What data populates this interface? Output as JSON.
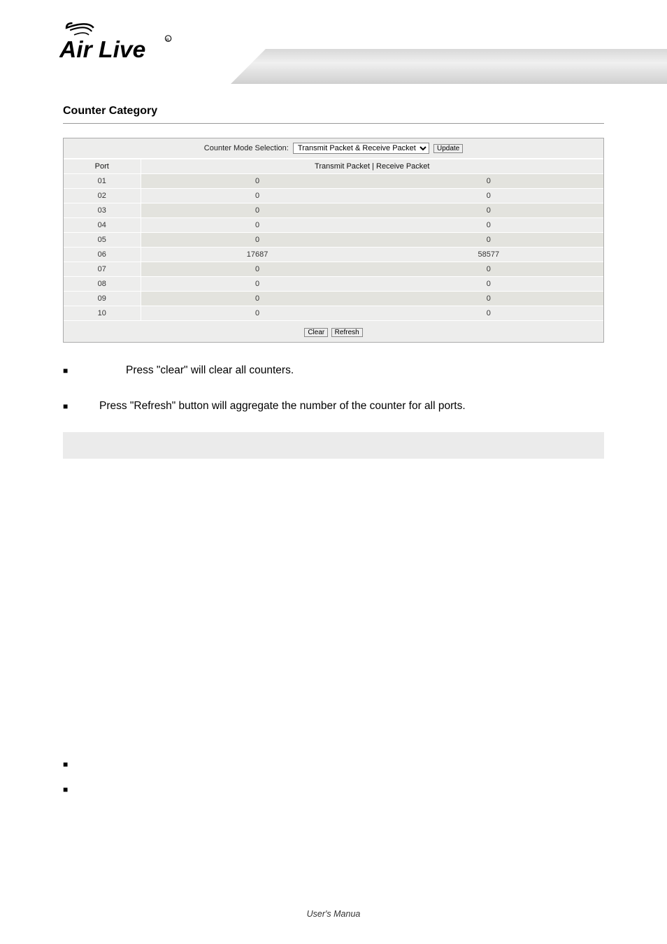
{
  "logo_text": "Air Live",
  "section_title": "Counter Category",
  "mode_label": "Counter Mode Selection:",
  "mode_value": "Transmit Packet & Receive Packet",
  "update_btn": "Update",
  "headers": {
    "port": "Port",
    "data": "Transmit Packet | Receive Packet"
  },
  "rows": [
    {
      "port": "01",
      "tx": "0",
      "rx": "0"
    },
    {
      "port": "02",
      "tx": "0",
      "rx": "0"
    },
    {
      "port": "03",
      "tx": "0",
      "rx": "0"
    },
    {
      "port": "04",
      "tx": "0",
      "rx": "0"
    },
    {
      "port": "05",
      "tx": "0",
      "rx": "0"
    },
    {
      "port": "06",
      "tx": "17687",
      "rx": "58577"
    },
    {
      "port": "07",
      "tx": "0",
      "rx": "0"
    },
    {
      "port": "08",
      "tx": "0",
      "rx": "0"
    },
    {
      "port": "09",
      "tx": "0",
      "rx": "0"
    },
    {
      "port": "10",
      "tx": "0",
      "rx": "0"
    }
  ],
  "clear_btn": "Clear",
  "refresh_btn": "Refresh",
  "bullets": [
    "Press \"clear\" will clear all counters.",
    "Press \"Refresh\" button will aggregate the number of the counter for all ports."
  ],
  "footer": "User's Manua"
}
